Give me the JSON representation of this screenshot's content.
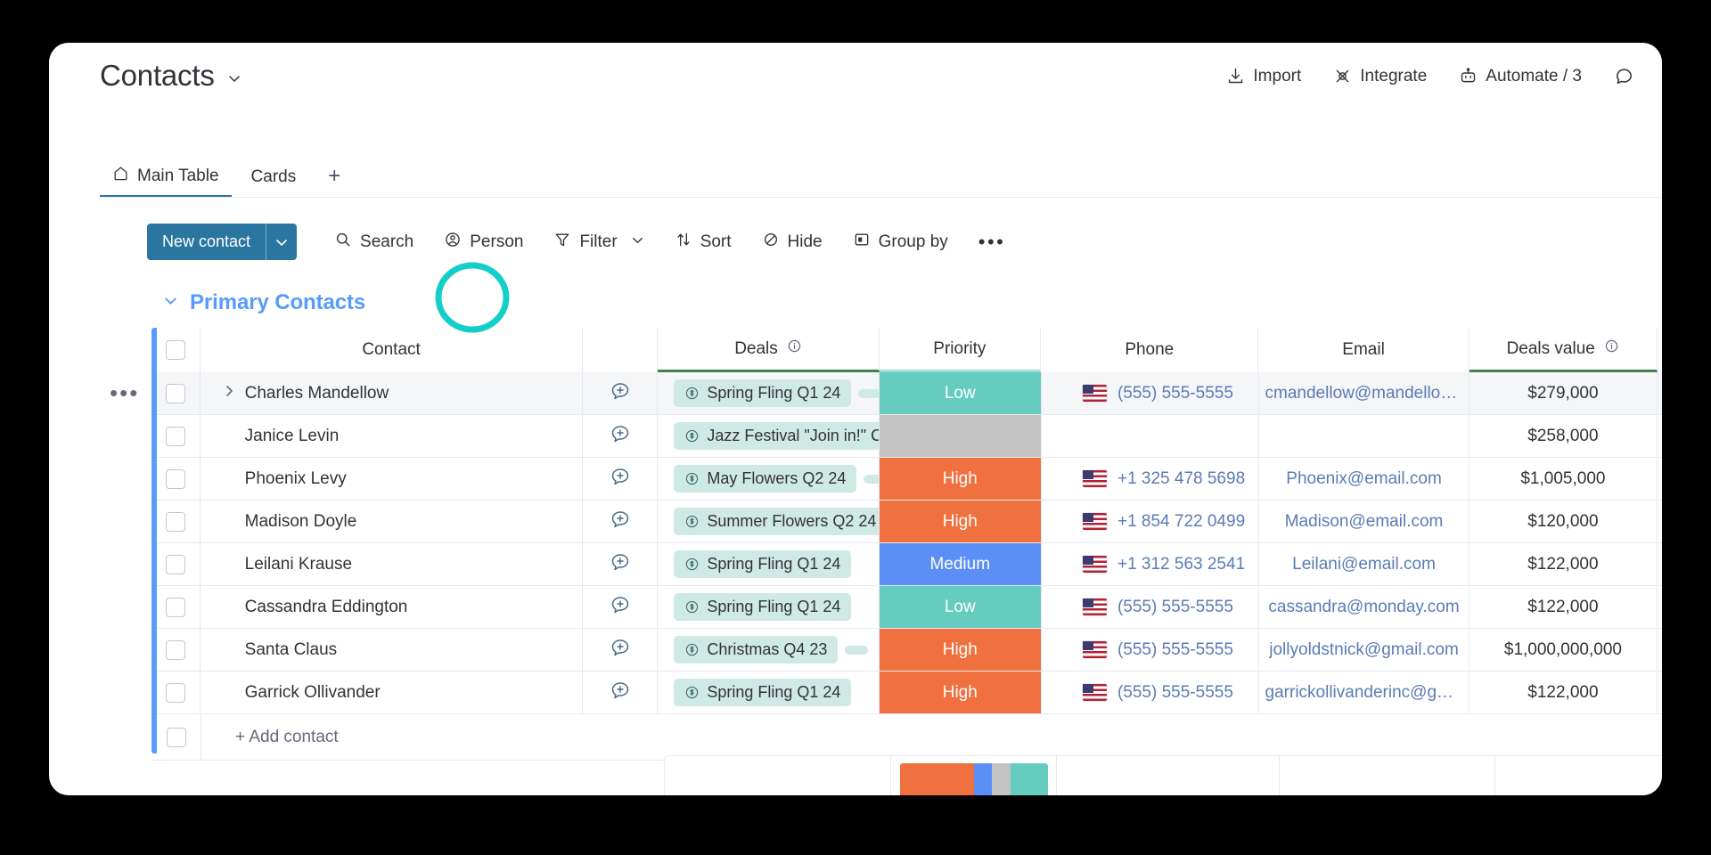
{
  "header": {
    "board_title": "Contacts",
    "title_chevron": "chevron-down-icon",
    "actions": [
      {
        "label": "Import",
        "icon": "import-icon"
      },
      {
        "label": "Integrate",
        "icon": "integrate-icon"
      },
      {
        "label": "Automate / 3",
        "icon": "robot-icon"
      }
    ],
    "chat_icon": "chat-bubble-icon"
  },
  "tabs": {
    "items": [
      {
        "label": "Main Table",
        "icon": "home-icon",
        "active": true
      },
      {
        "label": "Cards",
        "icon": "",
        "active": false
      }
    ],
    "add_label": "+"
  },
  "toolbar": {
    "new_button": "New contact",
    "new_button_caret": "chevron-down-icon",
    "items": [
      {
        "label": "Search",
        "icon": "search-icon"
      },
      {
        "label": "Person",
        "icon": "person-icon"
      },
      {
        "label": "Filter",
        "icon": "filter-icon",
        "caret": true
      },
      {
        "label": "Sort",
        "icon": "sort-icon"
      },
      {
        "label": "Hide",
        "icon": "hide-icon"
      },
      {
        "label": "Group by",
        "icon": "group-by-icon"
      }
    ],
    "more_label": "•••"
  },
  "group": {
    "name": "Primary Contacts",
    "collapse_icon": "chevron-down-icon",
    "row_menu": "•••"
  },
  "table": {
    "columns": [
      {
        "label": "Contact",
        "info": false
      },
      {
        "label": "Deals",
        "info": true
      },
      {
        "label": "Priority",
        "info": false
      },
      {
        "label": "Phone",
        "info": false
      },
      {
        "label": "Email",
        "info": false
      },
      {
        "label": "Deals value",
        "info": true
      }
    ],
    "add_column_label": "+",
    "rows": [
      {
        "name": "Charles Mandellow",
        "expand": true,
        "deal": "Spring Fling Q1 24",
        "deal_extra": true,
        "priority": "Low",
        "priority_color": "#66ccc0",
        "phone": "(555) 555-5555",
        "has_phone": true,
        "email": "cmandellow@mandellow....",
        "value": "$279,000",
        "highlighted": true
      },
      {
        "name": "Janice Levin",
        "expand": false,
        "deal": "Jazz Festival \"Join in!\" C",
        "deal_extra": false,
        "priority": "",
        "priority_color": "#c4c4c4",
        "phone": "",
        "has_phone": false,
        "email": "",
        "value": "$258,000",
        "highlighted": false
      },
      {
        "name": "Phoenix Levy",
        "expand": false,
        "deal": "May Flowers Q2 24",
        "deal_extra": true,
        "priority": "High",
        "priority_color": "#f1703f",
        "phone": "+1 325 478 5698",
        "has_phone": true,
        "email": "Phoenix@email.com",
        "value": "$1,005,000",
        "highlighted": false
      },
      {
        "name": "Madison Doyle",
        "expand": false,
        "deal": "Summer Flowers Q2 24",
        "deal_extra": false,
        "priority": "High",
        "priority_color": "#f1703f",
        "phone": "+1 854 722 0499",
        "has_phone": true,
        "email": "Madison@email.com",
        "value": "$120,000",
        "highlighted": false
      },
      {
        "name": "Leilani Krause",
        "expand": false,
        "deal": "Spring Fling Q1 24",
        "deal_extra": false,
        "priority": "Medium",
        "priority_color": "#5b8ff5",
        "phone": "+1 312 563 2541",
        "has_phone": true,
        "email": "Leilani@email.com",
        "value": "$122,000",
        "highlighted": false
      },
      {
        "name": "Cassandra Eddington",
        "expand": false,
        "deal": "Spring Fling Q1 24",
        "deal_extra": false,
        "priority": "Low",
        "priority_color": "#66ccc0",
        "phone": "(555) 555-5555",
        "has_phone": true,
        "email": "cassandra@monday.com",
        "value": "$122,000",
        "highlighted": false
      },
      {
        "name": "Santa Claus",
        "expand": false,
        "deal": "Christmas Q4 23",
        "deal_extra": true,
        "priority": "High",
        "priority_color": "#f1703f",
        "phone": "(555) 555-5555",
        "has_phone": true,
        "email": "jollyoldstnick@gmail.com",
        "value": "$1,000,000,000",
        "highlighted": false
      },
      {
        "name": "Garrick Ollivander",
        "expand": false,
        "deal": "Spring Fling Q1 24",
        "deal_extra": false,
        "priority": "High",
        "priority_color": "#f1703f",
        "phone": "(555) 555-5555",
        "has_phone": true,
        "email": "garrickollivanderinc@gm...",
        "value": "$122,000",
        "highlighted": false
      }
    ],
    "add_row_label": "+ Add contact"
  },
  "summary": {
    "priority_distribution": [
      {
        "label": "High",
        "color": "#f1703f",
        "weight": 4
      },
      {
        "label": "Medium",
        "color": "#5b8ff5",
        "weight": 1
      },
      {
        "label": "Empty",
        "color": "#c4c4c4",
        "weight": 1
      },
      {
        "label": "Low",
        "color": "#66ccc0",
        "weight": 2
      }
    ]
  },
  "annotation": {
    "highlight_shape": "ellipse",
    "highlight_color": "#14cfc9",
    "target": "add-update-icon-row-1"
  },
  "colors": {
    "accent": "#2b76a0",
    "group": "#579bfc",
    "link": "#5a7bb5",
    "chip_bg": "#cfe9e5",
    "deals_underline": "#41814f",
    "priority_underline": "#9fdfd6"
  }
}
